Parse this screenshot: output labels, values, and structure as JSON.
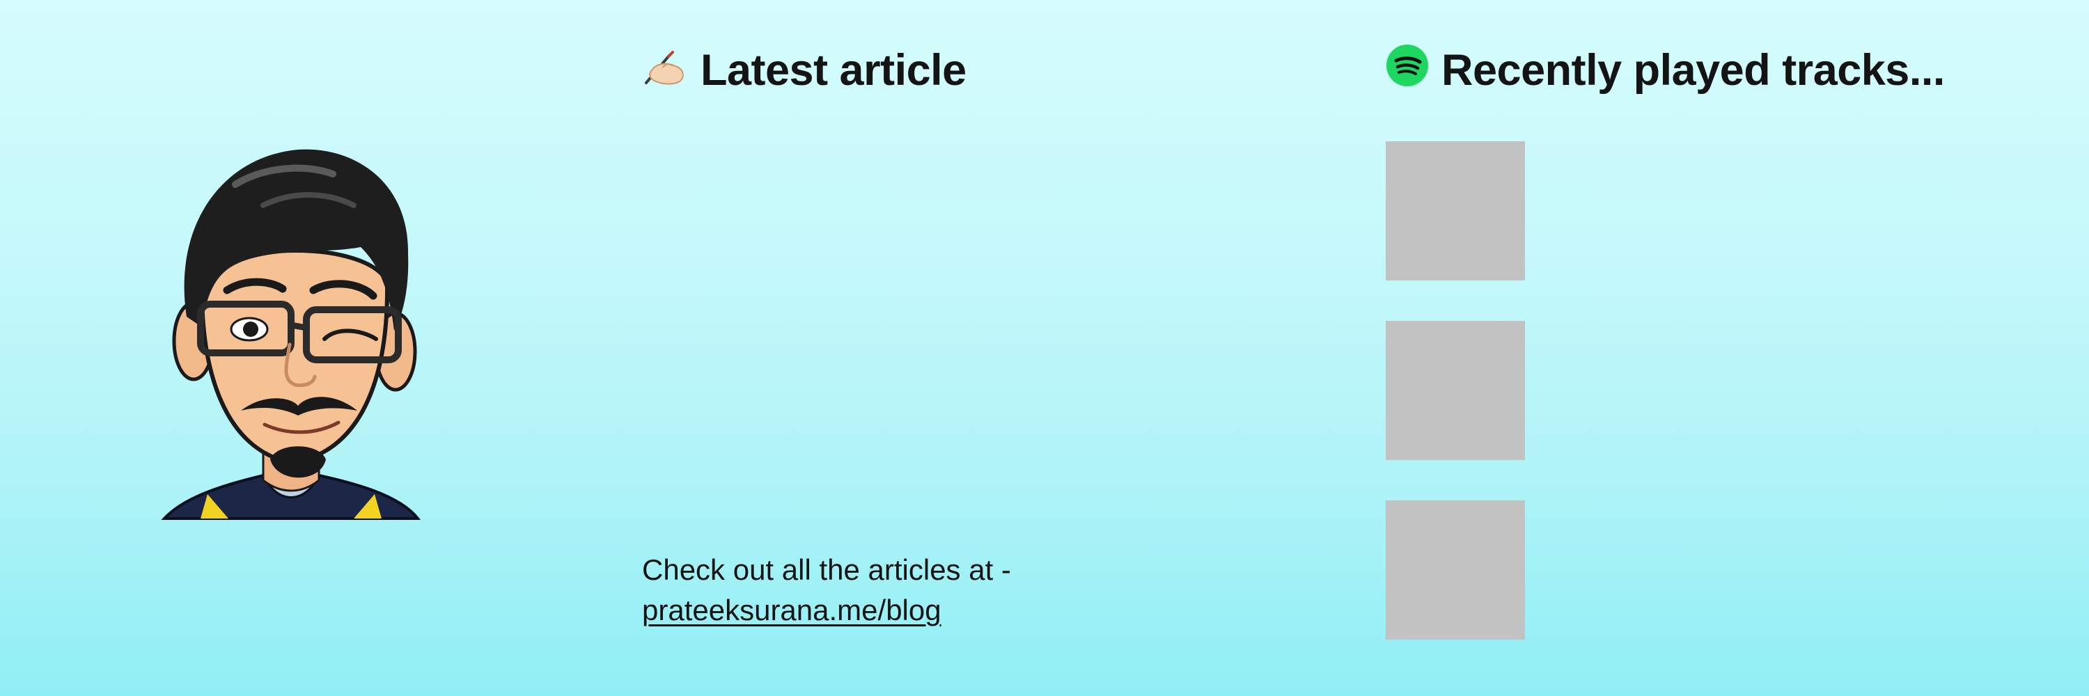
{
  "profile": {
    "avatar_icon": "memoji-avatar-icon"
  },
  "articles": {
    "heading_icon": "writing-hand-icon",
    "heading": "Latest article",
    "footer_text": "Check out all the articles at -",
    "footer_link": "prateeksurana.me/blog"
  },
  "tracks": {
    "heading_icon": "spotify-icon",
    "heading": "Recently played tracks...",
    "items": [
      {
        "art_icon": "album-art-placeholder"
      },
      {
        "art_icon": "album-art-placeholder"
      },
      {
        "art_icon": "album-art-placeholder"
      }
    ]
  },
  "colors": {
    "background_top": "#d6fcfd",
    "background_bottom": "#90eff5",
    "spotify_green": "#1ed760",
    "placeholder_gray": "#c2c2c2",
    "text": "#141414"
  }
}
